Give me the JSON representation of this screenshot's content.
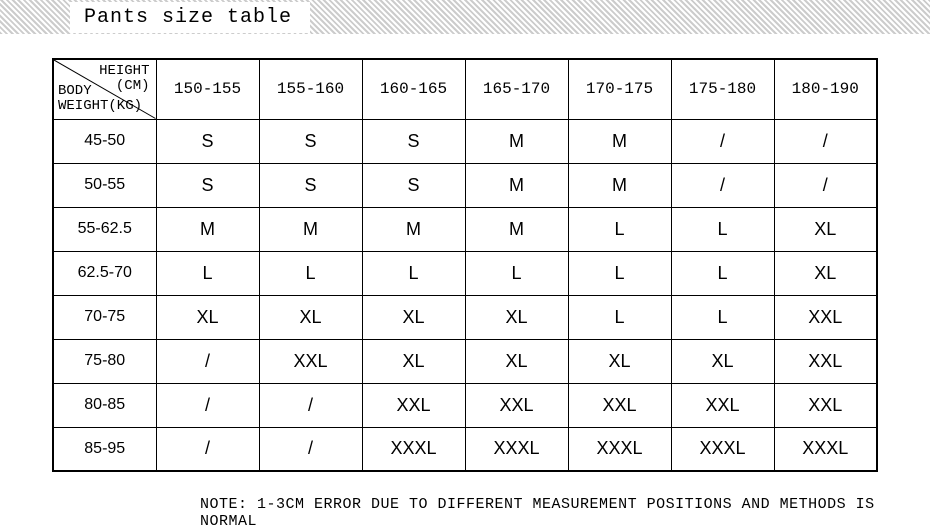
{
  "header": {
    "title": "Pants size table"
  },
  "chart_data": {
    "type": "table",
    "title": "Pants size table",
    "corner": {
      "top_label_line1": "HEIGHT",
      "top_label_line2": "(CM)",
      "bottom_label_line1": "BODY",
      "bottom_label_line2": "WEIGHT(KG)"
    },
    "columns": [
      "150-155",
      "155-160",
      "160-165",
      "165-170",
      "170-175",
      "175-180",
      "180-190"
    ],
    "rows": [
      "45-50",
      "50-55",
      "55-62.5",
      "62.5-70",
      "70-75",
      "75-80",
      "80-85",
      "85-95"
    ],
    "values": [
      [
        "S",
        "S",
        "S",
        "M",
        "M",
        "/",
        "/"
      ],
      [
        "S",
        "S",
        "S",
        "M",
        "M",
        "/",
        "/"
      ],
      [
        "M",
        "M",
        "M",
        "M",
        "L",
        "L",
        "XL"
      ],
      [
        "L",
        "L",
        "L",
        "L",
        "L",
        "L",
        "XL"
      ],
      [
        "XL",
        "XL",
        "XL",
        "XL",
        "L",
        "L",
        "XXL"
      ],
      [
        "/",
        "XXL",
        "XL",
        "XL",
        "XL",
        "XL",
        "XXL"
      ],
      [
        "/",
        "/",
        "XXL",
        "XXL",
        "XXL",
        "XXL",
        "XXL"
      ],
      [
        "/",
        "/",
        "XXXL",
        "XXXL",
        "XXXL",
        "XXXL",
        "XXXL"
      ]
    ]
  },
  "note": "NOTE: 1-3CM ERROR DUE TO DIFFERENT MEASUREMENT POSITIONS AND METHODS IS NORMAL"
}
